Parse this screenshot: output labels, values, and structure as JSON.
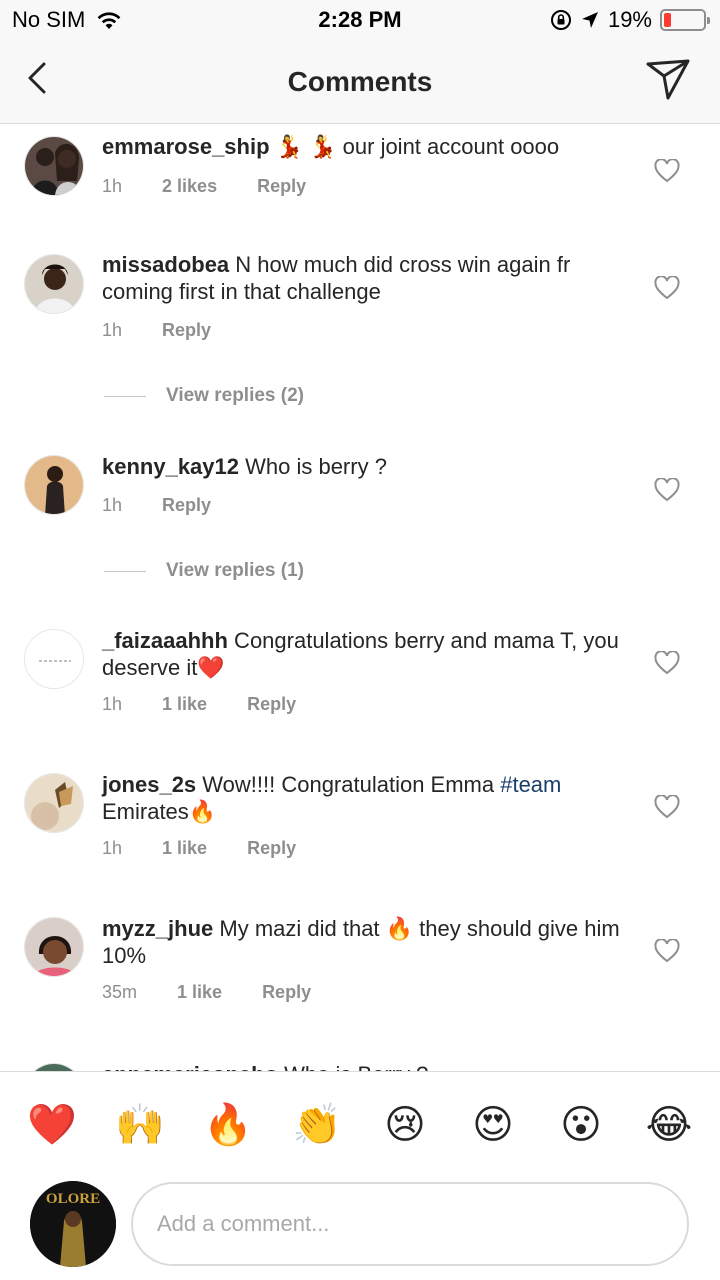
{
  "status_bar": {
    "carrier": "No SIM",
    "time": "2:28 PM",
    "battery": "19%",
    "battery_level": 0.19
  },
  "nav": {
    "title": "Comments",
    "back_icon": "chevron-left-icon",
    "send_icon": "paper-plane-icon"
  },
  "comments": [
    {
      "username": "emmarose_ship",
      "text_pre": " 💃 💃 our joint account oooo",
      "hashtag": "",
      "text_post": "",
      "time": "1h",
      "likes": "2 likes",
      "reply": "Reply"
    },
    {
      "username": "missadobea",
      "text_pre": " N how much did cross win again fr coming first in that challenge",
      "hashtag": "",
      "text_post": "",
      "time": "1h",
      "likes": "",
      "reply": "Reply",
      "view_replies": "View replies (2)"
    },
    {
      "username": "kenny_kay12",
      "text_pre": " Who is berry ?",
      "hashtag": "",
      "text_post": "",
      "time": "1h",
      "likes": "",
      "reply": "Reply",
      "view_replies": "View replies (1)"
    },
    {
      "username": "_faizaaahhh",
      "text_pre": " Congratulations berry and mama T, you deserve it❤️",
      "hashtag": "",
      "text_post": "",
      "time": "1h",
      "likes": "1 like",
      "reply": "Reply"
    },
    {
      "username": "jones_2s",
      "text_pre": " Wow!!!! Congratulation Emma ",
      "hashtag": "#team",
      "text_post": " Emirates🔥",
      "time": "1h",
      "likes": "1 like",
      "reply": "Reply"
    },
    {
      "username": "myzz_jhue",
      "text_pre": " My mazi did that 🔥 they should give him 10%",
      "hashtag": "",
      "text_post": "",
      "time": "35m",
      "likes": "1 like",
      "reply": "Reply"
    },
    {
      "username": "annemarieonabo",
      "text_pre": " Who is Berry ?",
      "hashtag": "",
      "text_post": "",
      "time": "",
      "likes": "",
      "reply": ""
    }
  ],
  "emoji_bar": [
    "❤️",
    "🙌",
    "🔥",
    "👏",
    "😢",
    "😍",
    "😮",
    "😂"
  ],
  "input": {
    "placeholder": "Add a comment...",
    "avatar_text": "OLORE"
  },
  "colors": {
    "hashtag": "#1a3f6b",
    "meta": "#8e8e8e",
    "battery_low": "#ff3b30"
  }
}
